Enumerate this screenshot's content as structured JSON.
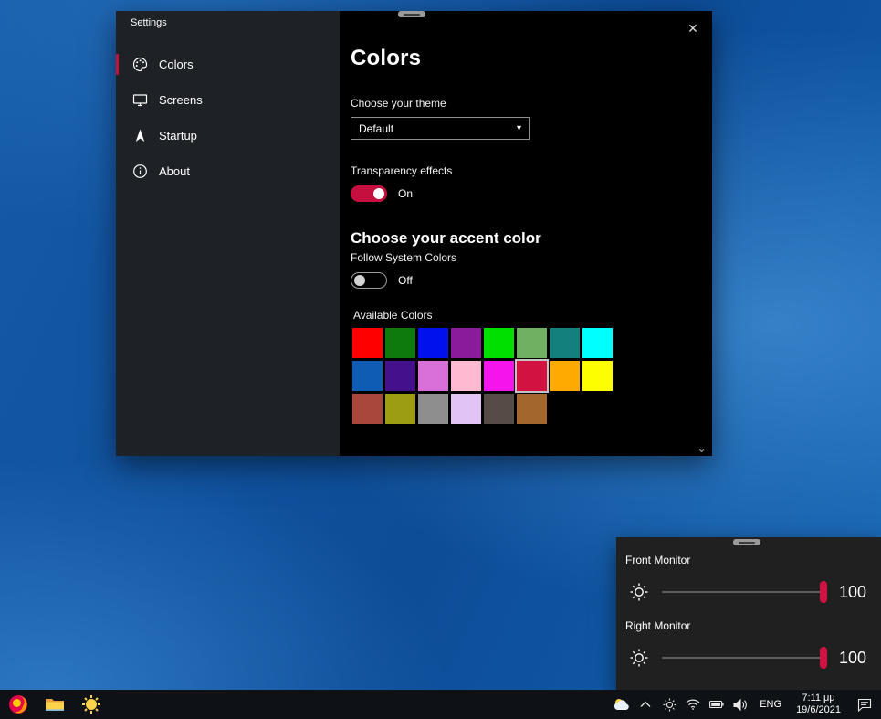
{
  "colors": {
    "accent": "#c50f3f",
    "accent_bright": "#d11141",
    "sidebar_bg": "#1e2227",
    "main_bg": "#000000",
    "desktop_base": "#0d4c97",
    "taskbar_bg": "#0e1216"
  },
  "icons": {
    "close": "✕",
    "dropdown_chevron": "▾",
    "scroll_chevron": "⌄"
  },
  "settings_window": {
    "title": "Settings",
    "sidebar": {
      "items": [
        {
          "label": "Colors",
          "icon": "palette-icon",
          "selected": true
        },
        {
          "label": "Screens",
          "icon": "monitor-icon",
          "selected": false
        },
        {
          "label": "Startup",
          "icon": "startup-arrow-icon",
          "selected": false
        },
        {
          "label": "About",
          "icon": "info-icon",
          "selected": false
        }
      ]
    },
    "page": {
      "heading": "Colors",
      "theme_label": "Choose your theme",
      "theme_value": "Default",
      "transparency_label": "Transparency effects",
      "transparency_state": "On",
      "accent_heading": "Choose your accent color",
      "follow_system_label": "Follow System Colors",
      "follow_system_state": "Off",
      "available_colors_label": "Available Colors",
      "swatch_rows": [
        [
          "#ff0000",
          "#0e7a0e",
          "#0011ee",
          "#8a1c9c",
          "#00e000",
          "#6fb062",
          "#13807d",
          "#00ffff"
        ],
        [
          "#0f5cb5",
          "#44108c",
          "#d96fd9",
          "#ffb9d0",
          "#f414ec",
          "#d21341",
          "#ffaa00",
          "#fdff00"
        ],
        [
          "#a8473c",
          "#9d9d13",
          "#8e8e8e",
          "#e2c3f5",
          "#564c45",
          "#a3672d"
        ]
      ],
      "selected_swatch": {
        "row": 1,
        "index": 5
      }
    }
  },
  "brightness_flyout": {
    "monitors": [
      {
        "name": "Front Monitor",
        "value": "100"
      },
      {
        "name": "Right Monitor",
        "value": "100"
      }
    ]
  },
  "taskbar": {
    "apps": [
      "firefox",
      "file-explorer",
      "brightness-app"
    ],
    "tray": {
      "language": "ENG",
      "time": "7:11 μμ",
      "date": "19/6/2021"
    }
  }
}
